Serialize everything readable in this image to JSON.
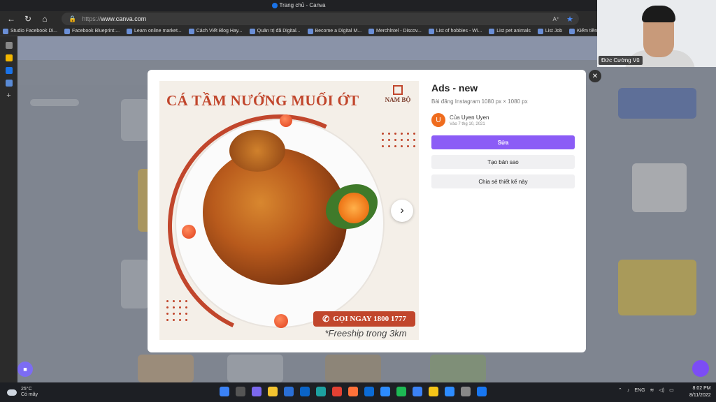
{
  "browser": {
    "tab_title": "Trang chủ - Canva",
    "url_scheme": "https://",
    "url_host": "www.canva.com",
    "reader_label": "A⁺",
    "bookmarks": [
      "Studio Facebook Di...",
      "Facebook Blueprint:...",
      "Learn online market...",
      "Cách Viết Blog Hay...",
      "Quản trị đã Digital...",
      "Become a Digital M...",
      "Merchlntel - Discov...",
      "List of hobbies - Wi...",
      "List pet animals",
      "List Job",
      "Kiếm tiền với Merc..."
    ]
  },
  "webcam": {
    "participant_name": "Đức Cường Vũ"
  },
  "modal": {
    "close_label": "✕",
    "design": {
      "headline": "CÁ TẦM NƯỚNG MUỐI ỚT",
      "brand": "NAM BỘ",
      "cta_label": "GỌI NGAY 1800 1777",
      "shipping_note": "*Freeship trong 3km"
    },
    "next_label": "›",
    "info": {
      "title": "Ads - new",
      "subtitle": "Bài đăng Instagram 1080 px × 1080 px",
      "author_initial": "U",
      "author_prefix": "Của",
      "author_name": "Uyen Uyen",
      "date": "Vào 7 thg 10, 2021",
      "edit_button": "Sửa",
      "copy_button": "Tạo bản sao",
      "share_button": "Chia sẻ thiết kế này"
    }
  },
  "taskbar": {
    "temperature": "25°C",
    "weather": "Có mây",
    "language": "ENG",
    "time": "8:02 PM",
    "date": "8/11/2022"
  },
  "colors": {
    "accent": "#8b5cf6",
    "brand_orange": "#c1462c",
    "avatar": "#ef6c1e"
  }
}
